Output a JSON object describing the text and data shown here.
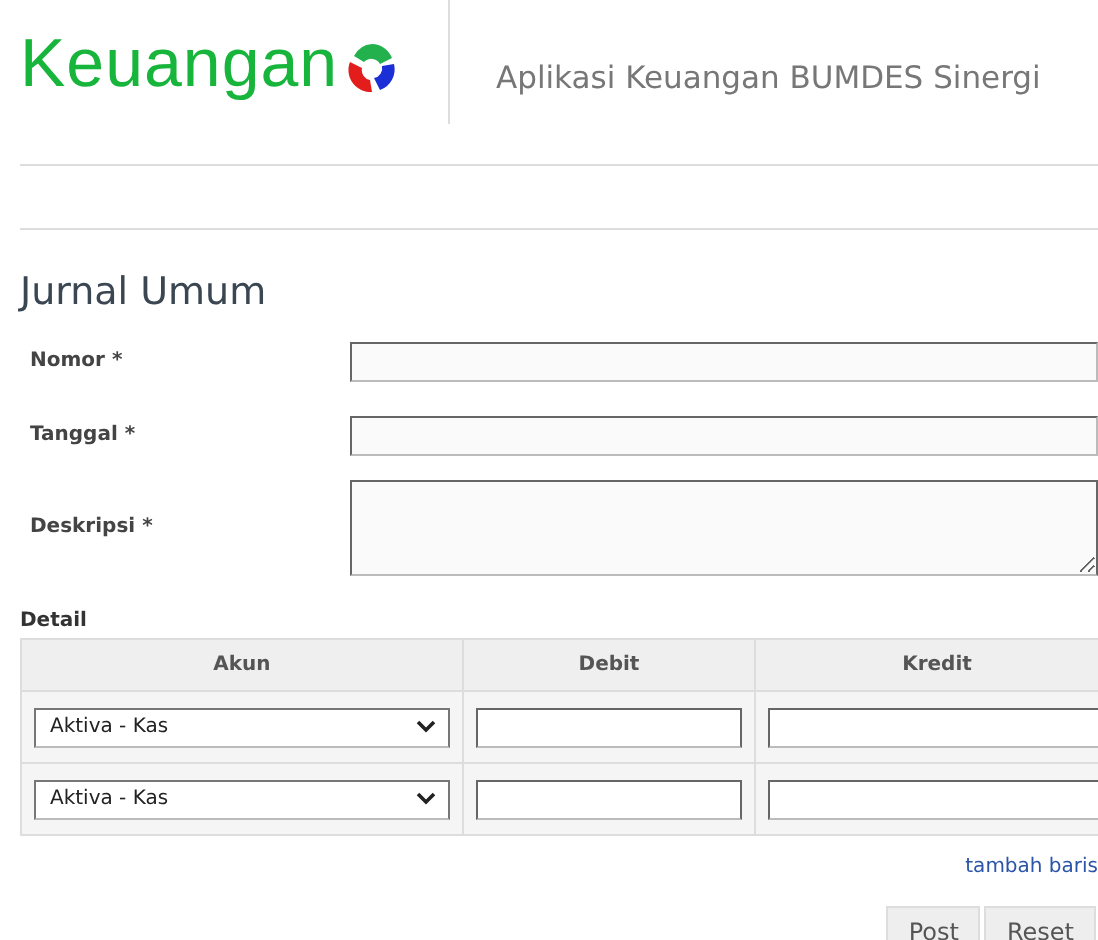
{
  "header": {
    "logo_text": "Keuangan",
    "app_title": "Aplikasi Keuangan BUMDES Sinergi"
  },
  "page_title": "Jurnal Umum",
  "fields": [
    {
      "label": "Nomor *",
      "kind": "input"
    },
    {
      "label": "Tanggal *",
      "kind": "input"
    },
    {
      "label": "Deskripsi *",
      "kind": "textarea"
    }
  ],
  "detail": {
    "label": "Detail",
    "columns": [
      "Akun",
      "Debit",
      "Kredit"
    ],
    "rows": [
      {
        "akun": "Aktiva - Kas"
      },
      {
        "akun": "Aktiva - Kas"
      }
    ],
    "add_row_link": "tambah baris"
  },
  "buttons": [
    "Post",
    "Reset"
  ]
}
